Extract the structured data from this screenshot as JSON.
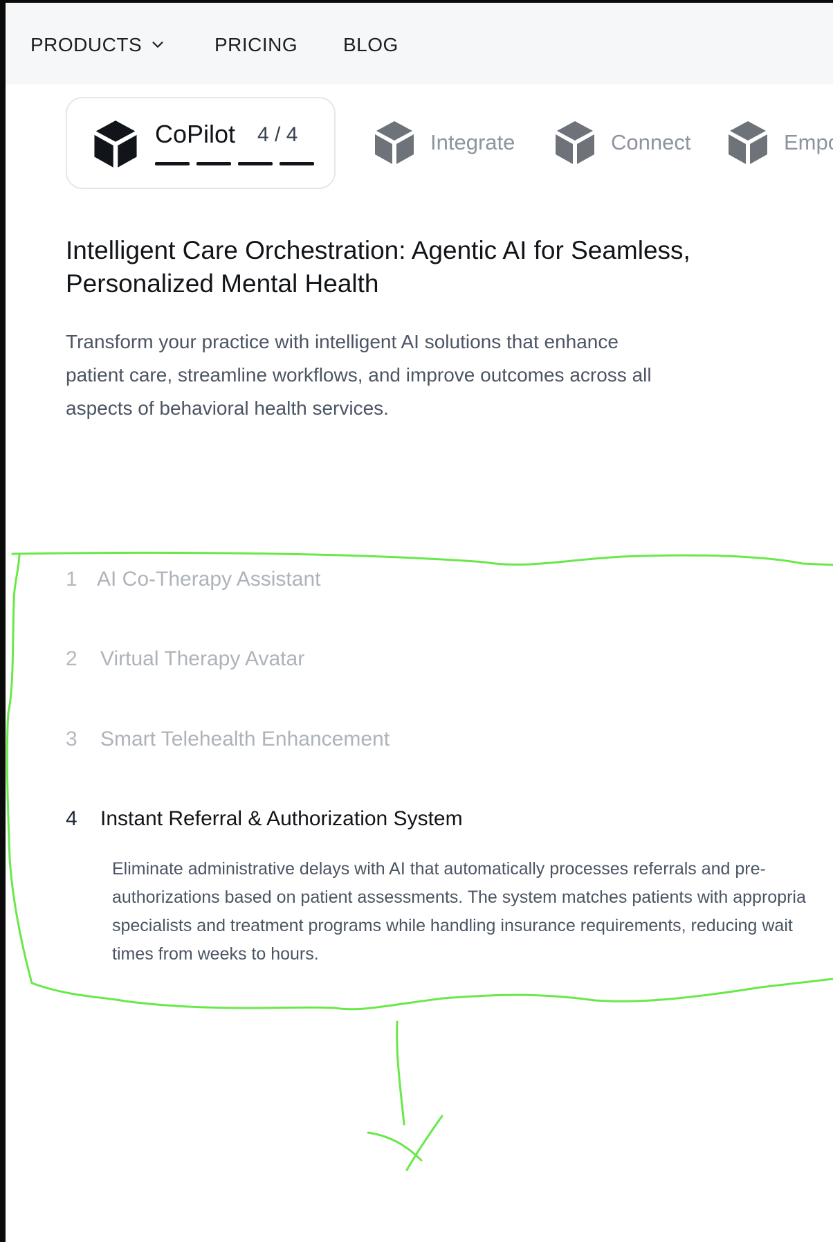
{
  "nav": {
    "products_label": "PRODUCTS",
    "pricing_label": "PRICING",
    "blog_label": "BLOG",
    "products_icon": "chevron-down-icon"
  },
  "tabs": {
    "active": {
      "label": "CoPilot",
      "count": "4 / 4",
      "progress_total": 4,
      "progress_filled": 4,
      "icon": "cube-icon"
    },
    "items": [
      {
        "label": "Integrate",
        "icon": "cube-icon"
      },
      {
        "label": "Connect",
        "icon": "cube-icon"
      },
      {
        "label": "Empo",
        "icon": "cube-icon"
      }
    ]
  },
  "hero": {
    "headline_line1": "Intelligent Care Orchestration: Agentic AI for Seamless,",
    "headline_line2": "Personalized Mental Health",
    "subtext_line1": "Transform your practice with intelligent AI solutions that enhance",
    "subtext_line2": "patient care, streamline workflows, and improve outcomes across all",
    "subtext_line3": "aspects of behavioral health services."
  },
  "features": [
    {
      "number": "1",
      "title": "AI Co-Therapy Assistant"
    },
    {
      "number": "2",
      "title": "Virtual Therapy Avatar"
    },
    {
      "number": "3",
      "title": "Smart Telehealth Enhancement"
    },
    {
      "number": "4",
      "title": "Instant Referral & Authorization System",
      "description_line1": "Eliminate administrative delays with AI that automatically processes referrals and pre-",
      "description_line2": "authorizations based on patient assessments. The system matches patients with appropria",
      "description_line3": "specialists and treatment programs while handling insurance requirements, reducing wait",
      "description_line4": "times from weeks to hours."
    }
  ],
  "colors": {
    "annotation": "#6ae84a",
    "nav_background": "#f6f7f9",
    "active_text": "#111418",
    "inactive_text": "#aeb3ba",
    "body_text": "#4b5563"
  }
}
